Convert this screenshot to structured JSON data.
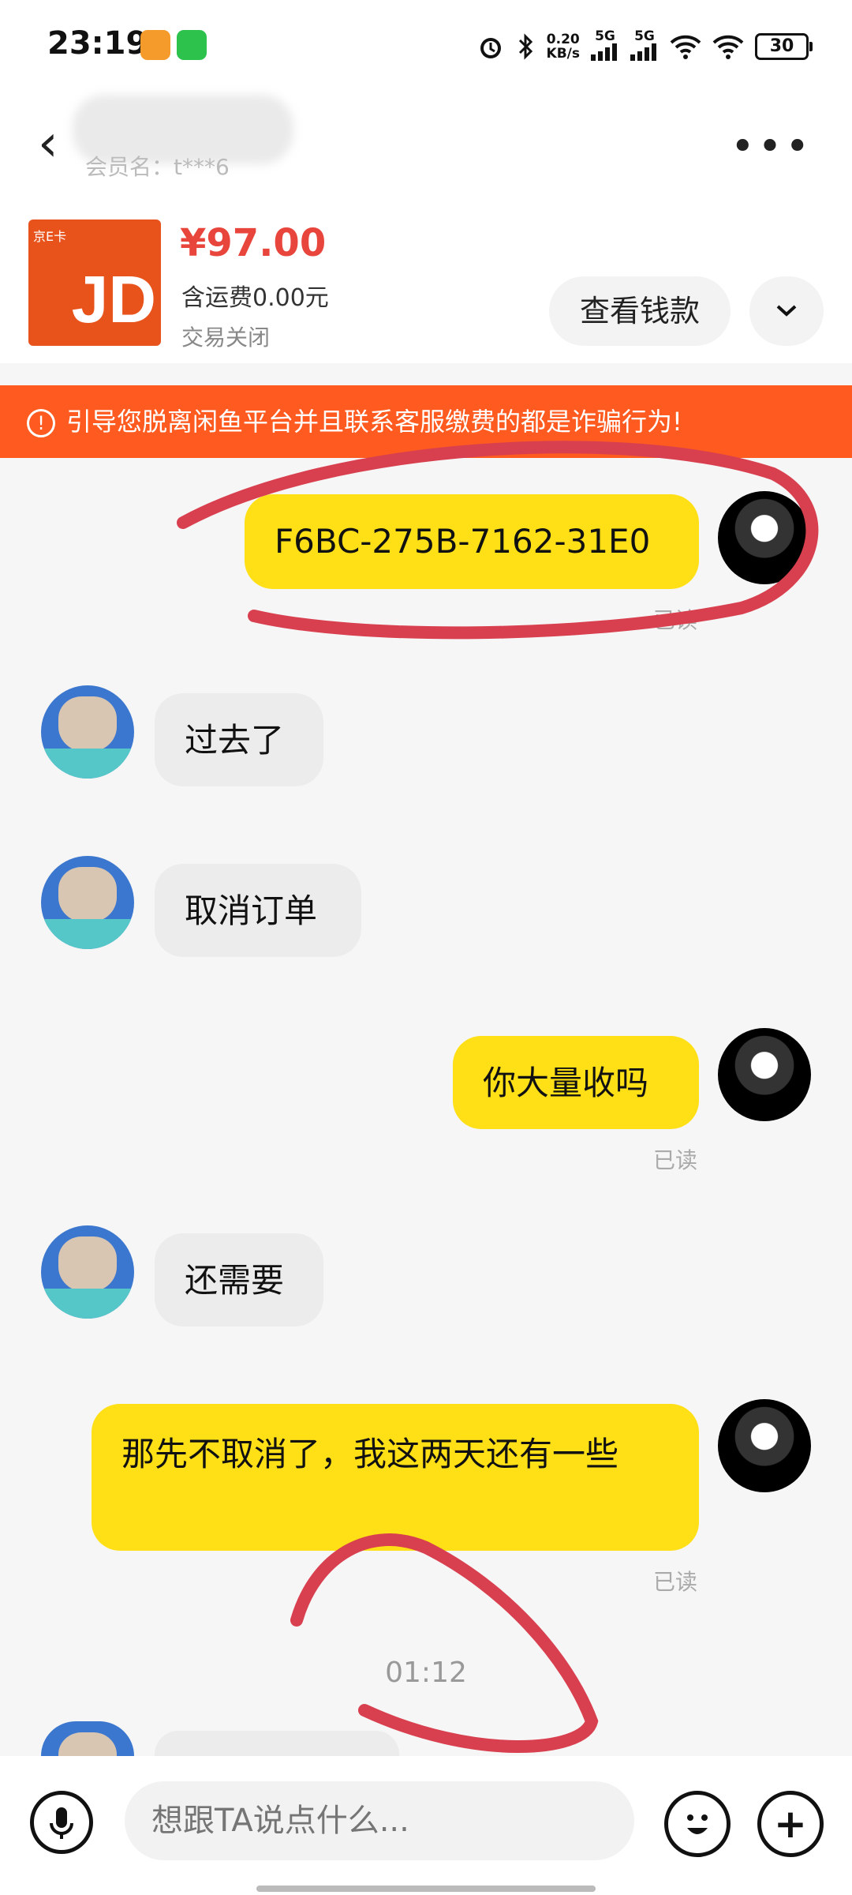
{
  "status_bar": {
    "time": "23:19",
    "net_speed_top": "0.20",
    "net_speed_bottom": "KB/s",
    "battery": "30",
    "signal_1": "5G",
    "signal_2": "5G"
  },
  "header": {
    "member_label": "会员名：t***6",
    "back_icon": "chevron-left-icon",
    "more_icon": "more-dots-icon"
  },
  "product": {
    "image_tag": "京E卡",
    "image_logo": "JD",
    "price": "¥97.00",
    "shipping": "含运费0.00元",
    "status": "交易关闭",
    "view_payment_button": "查看钱款"
  },
  "warning": {
    "text": "引导您脱离闲鱼平台并且联系客服缴费的都是诈骗行为!"
  },
  "messages": [
    {
      "from": "me",
      "text": "F6BC-275B-7162-31E0",
      "read": "已读"
    },
    {
      "from": "them",
      "text": "过去了"
    },
    {
      "from": "them",
      "text": "取消订单"
    },
    {
      "from": "me",
      "text": "你大量收吗",
      "read": "已读"
    },
    {
      "from": "them",
      "text": "还需要"
    },
    {
      "from": "me",
      "text": "那先不取消了，我这两天还有一些",
      "read": "已读"
    }
  ],
  "timestamp": "01:12",
  "input": {
    "placeholder": "想跟TA说点什么..."
  },
  "colors": {
    "accent_yellow": "#ffe016",
    "warning_orange": "#ff5a1f",
    "price_red": "#e8453c",
    "annotation_red": "#d9404f"
  }
}
